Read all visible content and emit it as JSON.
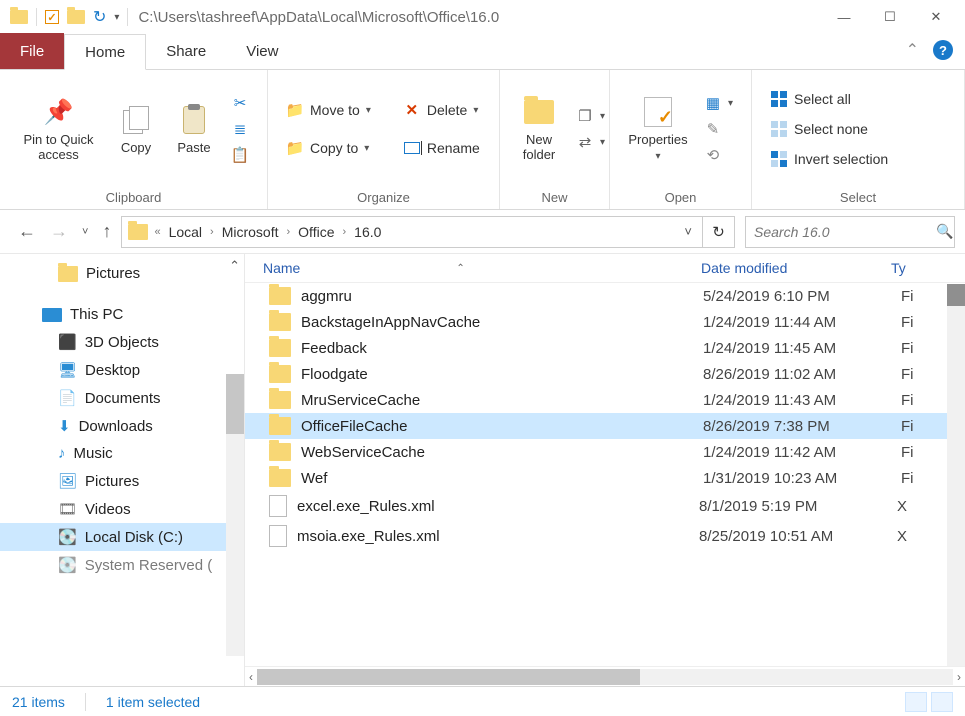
{
  "titlebar": {
    "path": "C:\\Users\\tashreef\\AppData\\Local\\Microsoft\\Office\\16.0",
    "qat_dropdown": "▾"
  },
  "tabs": {
    "file": "File",
    "home": "Home",
    "share": "Share",
    "view": "View"
  },
  "ribbon": {
    "clipboard": {
      "pin": "Pin to Quick access",
      "copy": "Copy",
      "paste": "Paste",
      "label": "Clipboard"
    },
    "organize": {
      "moveto": "Move to",
      "copyto": "Copy to",
      "delete": "Delete",
      "rename": "Rename",
      "label": "Organize"
    },
    "new": {
      "newfolder": "New folder",
      "label": "New"
    },
    "open": {
      "properties": "Properties",
      "label": "Open"
    },
    "select": {
      "all": "Select all",
      "none": "Select none",
      "invert": "Invert selection",
      "label": "Select"
    }
  },
  "breadcrumb": {
    "parts": [
      "Local",
      "Microsoft",
      "Office",
      "16.0"
    ]
  },
  "search": {
    "placeholder": "Search 16.0"
  },
  "columns": {
    "name": "Name",
    "date": "Date modified",
    "type": "Ty"
  },
  "navpane": {
    "pictures": "Pictures",
    "thispc": "This PC",
    "objects3d": "3D Objects",
    "desktop": "Desktop",
    "documents": "Documents",
    "downloads": "Downloads",
    "music": "Music",
    "pictures2": "Pictures",
    "videos": "Videos",
    "localdisk": "Local Disk (C:)",
    "sysres": "System Reserved ("
  },
  "files": [
    {
      "name": "aggmru",
      "date": "5/24/2019 6:10 PM",
      "type": "Fi",
      "kind": "folder",
      "sel": false
    },
    {
      "name": "BackstageInAppNavCache",
      "date": "1/24/2019 11:44 AM",
      "type": "Fi",
      "kind": "folder",
      "sel": false
    },
    {
      "name": "Feedback",
      "date": "1/24/2019 11:45 AM",
      "type": "Fi",
      "kind": "folder",
      "sel": false
    },
    {
      "name": "Floodgate",
      "date": "8/26/2019 11:02 AM",
      "type": "Fi",
      "kind": "folder",
      "sel": false
    },
    {
      "name": "MruServiceCache",
      "date": "1/24/2019 11:43 AM",
      "type": "Fi",
      "kind": "folder",
      "sel": false
    },
    {
      "name": "OfficeFileCache",
      "date": "8/26/2019 7:38 PM",
      "type": "Fi",
      "kind": "folder",
      "sel": true
    },
    {
      "name": "WebServiceCache",
      "date": "1/24/2019 11:42 AM",
      "type": "Fi",
      "kind": "folder",
      "sel": false
    },
    {
      "name": "Wef",
      "date": "1/31/2019 10:23 AM",
      "type": "Fi",
      "kind": "folder",
      "sel": false
    },
    {
      "name": "excel.exe_Rules.xml",
      "date": "8/1/2019 5:19 PM",
      "type": "X",
      "kind": "file",
      "sel": false
    },
    {
      "name": "msoia.exe_Rules.xml",
      "date": "8/25/2019 10:51 AM",
      "type": "X",
      "kind": "file",
      "sel": false
    }
  ],
  "status": {
    "count": "21 items",
    "selected": "1 item selected"
  }
}
